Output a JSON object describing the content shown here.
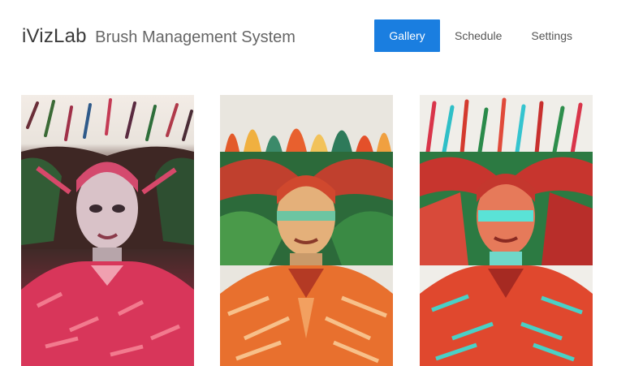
{
  "header": {
    "brand_name": "iVizLab",
    "brand_subtitle": "Brush Management System"
  },
  "nav": {
    "items": [
      {
        "label": "Gallery",
        "active": true
      },
      {
        "label": "Schedule",
        "active": false
      },
      {
        "label": "Settings",
        "active": false
      }
    ],
    "accent_color": "#1a7ee0"
  },
  "gallery": {
    "images": [
      {
        "icon": "portrait-painting-pink-palette"
      },
      {
        "icon": "portrait-painting-orange-green-palette"
      },
      {
        "icon": "portrait-painting-red-cyan-palette"
      }
    ]
  }
}
